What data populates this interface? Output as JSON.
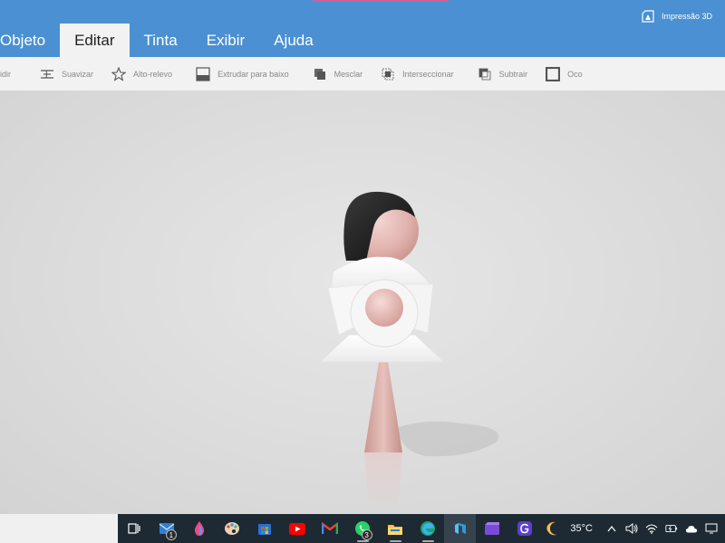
{
  "menu": {
    "tabs": [
      {
        "label": "Objeto"
      },
      {
        "label": "Editar"
      },
      {
        "label": "Tinta"
      },
      {
        "label": "Exibir"
      },
      {
        "label": "Ajuda"
      }
    ],
    "active_tab": "Editar",
    "print3d_label": "Impressão 3D"
  },
  "toolbar": {
    "items": [
      {
        "label": "idir",
        "icon": "cut-icon"
      },
      {
        "label": "Suavizar",
        "icon": "smooth-icon"
      },
      {
        "label": "Alto-relevo",
        "icon": "star-icon"
      },
      {
        "label": "Extrudar para baixo",
        "icon": "extrude-icon"
      },
      {
        "label": "Mesclar",
        "icon": "merge-icon"
      },
      {
        "label": "Interseccionar",
        "icon": "intersect-icon"
      },
      {
        "label": "Subtrair",
        "icon": "subtract-icon"
      },
      {
        "label": "Oco",
        "icon": "hollow-icon"
      }
    ]
  },
  "taskbar": {
    "mail_badge": "1",
    "whatsapp_badge": "3",
    "temperature": "35°C"
  },
  "colors": {
    "ribbon": "#4a90d2",
    "toolbar_bg": "#f2f2f2",
    "viewport_bg": "#dcdcdc",
    "taskbar_bg": "#1d2a33"
  }
}
